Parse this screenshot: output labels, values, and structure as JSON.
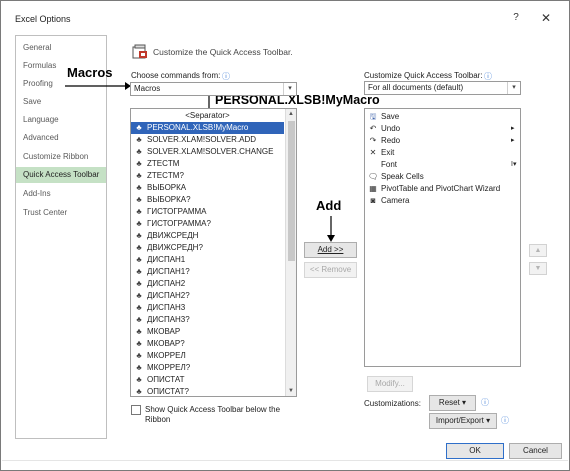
{
  "window": {
    "title": "Excel Options",
    "help": "?",
    "close": "✕"
  },
  "nav": {
    "items": [
      {
        "label": "General"
      },
      {
        "label": "Formulas"
      },
      {
        "label": "Proofing"
      },
      {
        "label": "Save"
      },
      {
        "label": "Language"
      },
      {
        "label": "Advanced"
      },
      {
        "label": "Customize Ribbon"
      },
      {
        "label": "Quick Access Toolbar"
      },
      {
        "label": "Add-Ins"
      },
      {
        "label": "Trust Center"
      }
    ],
    "active": "Quick Access Toolbar"
  },
  "header": {
    "text": "Customize the Quick Access Toolbar.",
    "icon": "qat-customize-icon"
  },
  "left": {
    "choose_label": "Choose commands from:",
    "info_icon": "ⓘ",
    "choose_value": "Macros",
    "commands": [
      {
        "label": "<Separator>",
        "icon": ""
      },
      {
        "label": "PERSONAL.XLSB!MyMacro",
        "icon": "macro-icon",
        "selected": true
      },
      {
        "label": "SOLVER.XLAM!SOLVER.ADD",
        "icon": "macro-icon"
      },
      {
        "label": "SOLVER.XLAM!SOLVER.CHANGE",
        "icon": "macro-icon"
      },
      {
        "label": "ZTECTM",
        "icon": "macro-icon"
      },
      {
        "label": "ZTECTM?",
        "icon": "macro-icon"
      },
      {
        "label": "ВЫБОРКА",
        "icon": "macro-icon"
      },
      {
        "label": "ВЫБОРКА?",
        "icon": "macro-icon"
      },
      {
        "label": "ГИСТОГРАММА",
        "icon": "macro-icon"
      },
      {
        "label": "ГИСТОГРАММА?",
        "icon": "macro-icon"
      },
      {
        "label": "ДВИЖСРЕДН",
        "icon": "macro-icon"
      },
      {
        "label": "ДВИЖСРЕДН?",
        "icon": "macro-icon"
      },
      {
        "label": "ДИСПАН1",
        "icon": "macro-icon"
      },
      {
        "label": "ДИСПАН1?",
        "icon": "macro-icon"
      },
      {
        "label": "ДИСПАН2",
        "icon": "macro-icon"
      },
      {
        "label": "ДИСПАН2?",
        "icon": "macro-icon"
      },
      {
        "label": "ДИСПАН3",
        "icon": "macro-icon"
      },
      {
        "label": "ДИСПАН3?",
        "icon": "macro-icon"
      },
      {
        "label": "МКОВАР",
        "icon": "macro-icon"
      },
      {
        "label": "МКОВАР?",
        "icon": "macro-icon"
      },
      {
        "label": "МКОРРЕЛ",
        "icon": "macro-icon"
      },
      {
        "label": "МКОРРЕЛ?",
        "icon": "macro-icon"
      },
      {
        "label": "ОПИСТАТ",
        "icon": "macro-icon"
      },
      {
        "label": "ОПИСТАТ?",
        "icon": "macro-icon"
      }
    ],
    "show_below_label_1": "Show Quick Access Toolbar below the",
    "show_below_label_2": "Ribbon"
  },
  "middle": {
    "add_label": "Add >>",
    "remove_label": "<< Remove"
  },
  "right": {
    "customize_label": "Customize Quick Access Toolbar:",
    "info_icon": "ⓘ",
    "doc_value": "For all documents (default)",
    "items": [
      {
        "label": "Save",
        "icon": "save-icon",
        "glyph": "🖫",
        "sub": ""
      },
      {
        "label": "Undo",
        "icon": "undo-icon",
        "glyph": "↶",
        "sub": "▸"
      },
      {
        "label": "Redo",
        "icon": "redo-icon",
        "glyph": "↷",
        "sub": "▸"
      },
      {
        "label": "Exit",
        "icon": "exit-icon",
        "glyph": "✕",
        "sub": ""
      },
      {
        "label": "Font",
        "icon": "font-icon",
        "glyph": "",
        "sub": "I▾"
      },
      {
        "label": "Speak Cells",
        "icon": "speak-cells-icon",
        "glyph": "🗨",
        "sub": ""
      },
      {
        "label": "PivotTable and PivotChart Wizard",
        "icon": "pivot-wizard-icon",
        "glyph": "▦",
        "sub": ""
      },
      {
        "label": "Camera",
        "icon": "camera-icon",
        "glyph": "◙",
        "sub": ""
      }
    ],
    "modify_label": "Modify...",
    "customizations_label": "Customizations:",
    "reset_label": "Reset ▾",
    "import_export_label": "Import/Export ▾"
  },
  "footer": {
    "ok_label": "OK",
    "cancel_label": "Cancel"
  },
  "annotations": {
    "macros": "Macros",
    "personal": "PERSONAL.XLSB!MyMacro",
    "add": "Add"
  }
}
